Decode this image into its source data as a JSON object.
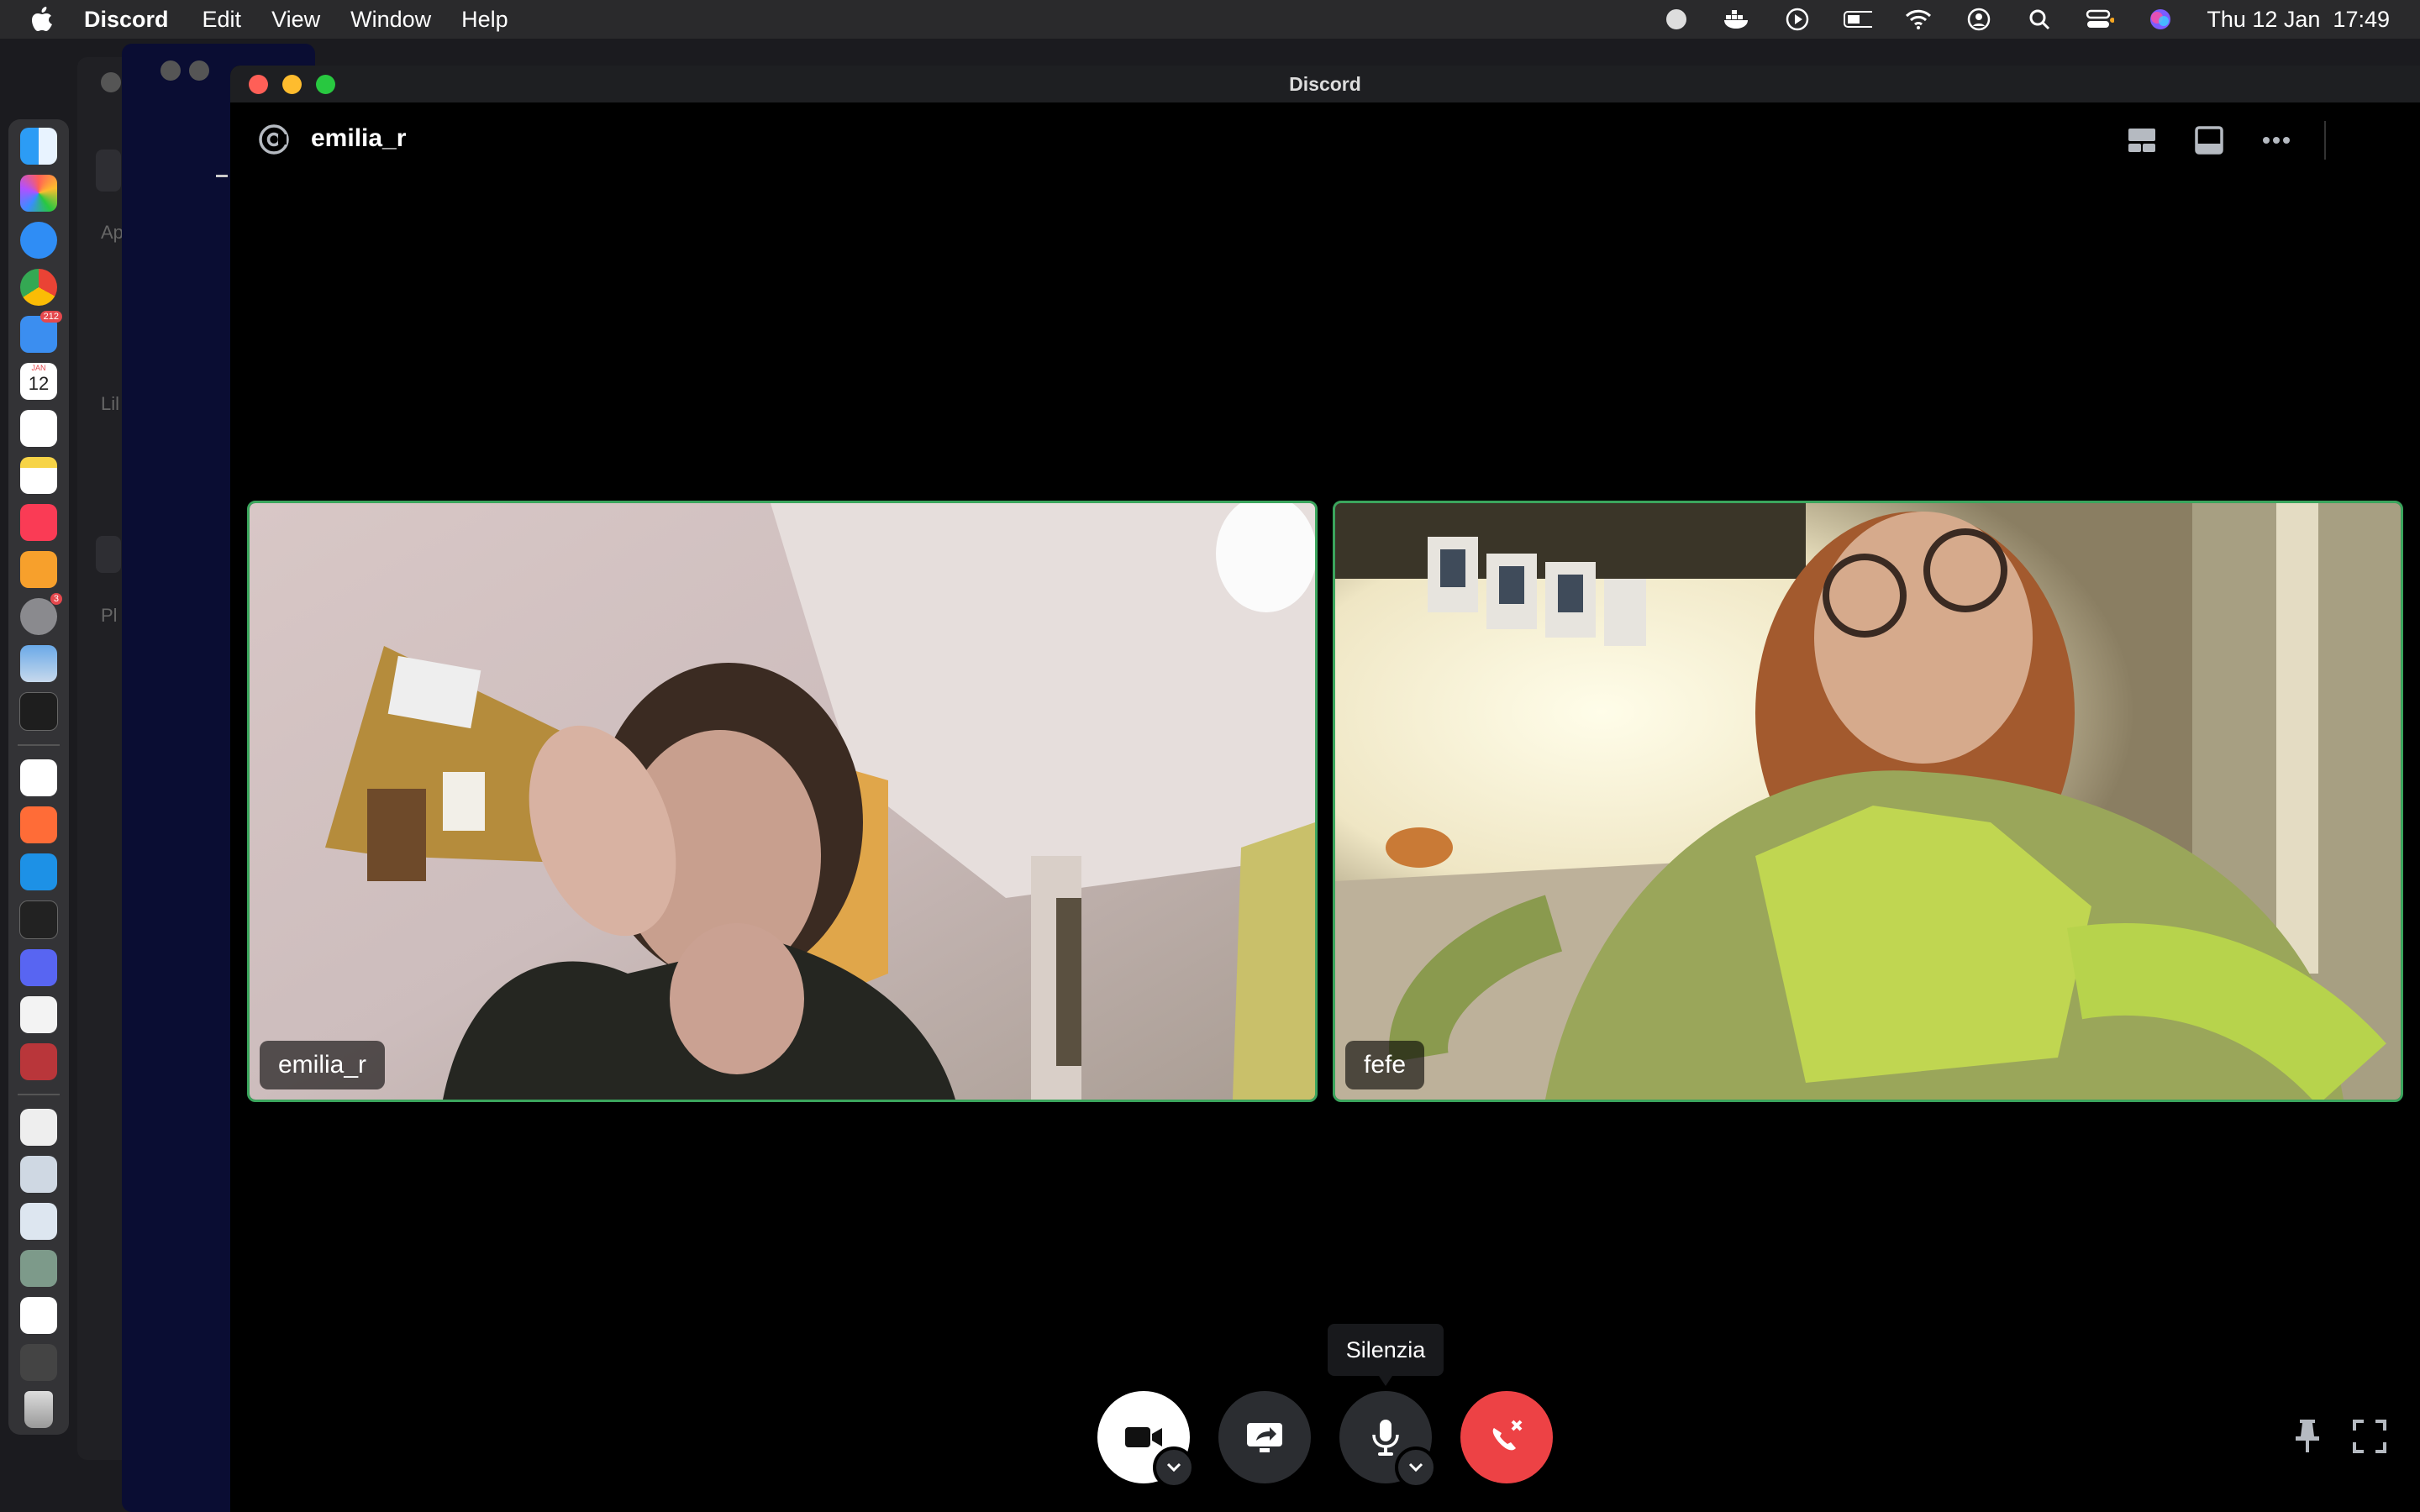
{
  "menubar": {
    "app_name": "Discord",
    "items": [
      "Edit",
      "View",
      "Window",
      "Help"
    ],
    "clock": "Thu 12 Jan  17:49"
  },
  "dock": {
    "mail_badge": "212",
    "calendar_day": "12",
    "calendar_month": "JAN",
    "settings_badge": "3"
  },
  "background": {
    "labels": [
      "Ap",
      "Lil",
      "Pl"
    ]
  },
  "window": {
    "title": "Discord"
  },
  "call": {
    "channel_name": "emilia_r",
    "participants": [
      {
        "name": "emilia_r",
        "speaking": true
      },
      {
        "name": "fefe",
        "speaking": true
      }
    ],
    "tooltip": "Silenzia"
  },
  "colors": {
    "speaking_border": "#3ba55d",
    "end_call": "#ed4245",
    "control_bg": "#2b2d31"
  }
}
